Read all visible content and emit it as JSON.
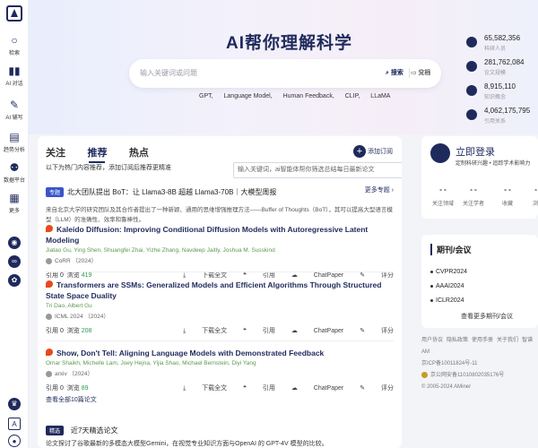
{
  "rail": {
    "items": [
      {
        "icon": "search-icon",
        "label": "检索"
      },
      {
        "icon": "book-icon",
        "label": "AI 对话"
      },
      {
        "icon": "pen-icon",
        "label": "AI 辅写"
      },
      {
        "icon": "chart-icon",
        "label": "趋势分析"
      },
      {
        "icon": "database-icon",
        "label": "数据平台"
      },
      {
        "icon": "grid-icon",
        "label": "更多"
      }
    ]
  },
  "hero": {
    "title": "AI帮你理解科学",
    "search_placeholder": "输入关键词或问题",
    "search_btn": "搜索",
    "analyze_btn": "分析",
    "doc_btn": "文档",
    "tags": [
      "GPT,",
      "Language Model,",
      "Human Feedback,",
      "CLIP,",
      "LLaMA"
    ]
  },
  "stats": [
    {
      "num": "65,582,356",
      "cap": "科研人员"
    },
    {
      "num": "281,762,084",
      "cap": "论文规模"
    },
    {
      "num": "8,915,110",
      "cap": "知识概念"
    },
    {
      "num": "4,062,175,795",
      "cap": "引用关系"
    }
  ],
  "feed": {
    "tabs": [
      "关注",
      "推荐",
      "热点"
    ],
    "subscribe": "添加订阅",
    "hint": "以下为热门内容推荐，添加订阅后推荐更精准",
    "tooltip": "输入关键词，ai智能体帮你筛选总结每日最新论文",
    "topic": {
      "badge": "专题",
      "title": "北大团队提出 BoT：让 Llama3-8B 超越 Llama3-70B｜大模型周报",
      "more": "更多专题",
      "desc": "来自北京大学的研究团队及其合作者提出了一种新颖、通用的思维增强推理方法——Buffer of Thoughts（BoT），其可以提高大型语言模型（LLM）的准确性、效率和鲁棒性。"
    },
    "papers": [
      {
        "title": "Kaleido Diffusion: Improving Conditional Diffusion Models with Autoregressive Latent Modeling",
        "authors": "Jiatao Gu, Ying Shen, Shuangfei Zhai, Yizhe Zhang, Navdeep Jaitly, Joshua M. Susskind",
        "venue": "CoRR （2024）",
        "cite_label": "引用",
        "cites": "0",
        "view_label": "浏览",
        "views": "419"
      },
      {
        "title": "Transformers are SSMs: Generalized Models and Efficient Algorithms Through Structured State Space Duality",
        "authors": "Tri Dao, Albert Gu",
        "venue": "ICML 2024 （2024）",
        "cite_label": "引用",
        "cites": "0",
        "view_label": "浏览",
        "views": "208"
      },
      {
        "title": "Show, Don't Tell: Aligning Language Models with Demonstrated Feedback",
        "authors": "Omar Shaikh, Michelle Lam, Joey Hejna, Yijia Shao, Michael Bernstein, Diyi Yang",
        "venue": "arxiv （2024）",
        "cite_label": "引用",
        "cites": "0",
        "view_label": "浏览",
        "views": "89"
      }
    ],
    "actions": {
      "download": "下载全文",
      "cite": "引用",
      "chat": "ChatPaper",
      "rate": "评分"
    },
    "view_all": "查看全部10篇论文",
    "weekly": {
      "badge": "精选",
      "title": "近7天精选论文",
      "desc": "论文探讨了谷歌最新的多模态大模型Gemini，在视觉专业知识方面与OpenAI 的 GPT-4V 模型的比较。"
    }
  },
  "login": {
    "title": "立即登录",
    "sub": "定制科研兴趣 • 追踪学术影响力",
    "cols": [
      {
        "val": "- -",
        "cap": "关注领域"
      },
      {
        "val": "- -",
        "cap": "关注学者"
      },
      {
        "val": "- -",
        "cap": "收藏"
      },
      {
        "val": "- -",
        "cap": "浏览"
      }
    ]
  },
  "journals": {
    "heading": "期刊/会议",
    "items": [
      "CVPR2024",
      "AAAI2024",
      "ICLR2024"
    ],
    "more": "查看更多期刊/会议"
  },
  "footer": {
    "links": [
      "用户协议",
      "隐私政策",
      "使用手册",
      "关于我们",
      "智谱 AM"
    ],
    "icp": "京ICP备10011824号-11",
    "police": "京公网安备11010802035176号",
    "copyright": "© 2005-2024 AMiner"
  }
}
